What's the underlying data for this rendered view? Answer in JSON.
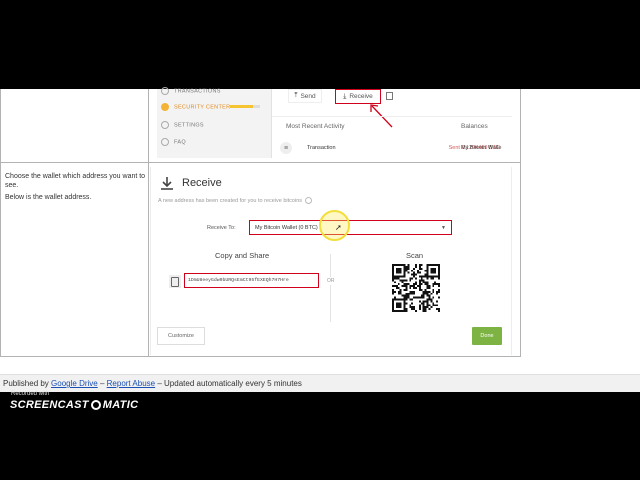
{
  "sidebar": {
    "items": [
      {
        "label": "TRANSACTIONS",
        "icon": "transactions-icon"
      },
      {
        "label": "SECURITY CENTER",
        "icon": "shield-icon",
        "active": true,
        "progress": 0.75
      },
      {
        "label": "SETTINGS",
        "icon": "gear-icon"
      },
      {
        "label": "FAQ",
        "icon": "question-icon"
      }
    ]
  },
  "toolbar": {
    "send_label": "Send",
    "receive_label": "Receive"
  },
  "activity": {
    "header": "Most Recent Activity",
    "balances_header": "Balances",
    "row": {
      "type": "Transaction",
      "amount": "Sent 0.1204469 BTC",
      "wallet": "My Bitcoin Walle"
    }
  },
  "instructions": {
    "line1": "Choose the wallet which address you want to see.",
    "line2": "Below is the wallet address."
  },
  "receive": {
    "title": "Receive",
    "subtitle": "A new address has been created for you to receive bitcoins",
    "receive_to_label": "Receive To:",
    "wallet_selected": "My Bitcoin Wallet  (0 BTC)",
    "copy_share": "Copy and Share",
    "or": "OR",
    "scan": "Scan",
    "address": "1DmU8eeyGdw9bURQsEmCt95fEXEQh7H7Hre",
    "customize_label": "Customize",
    "done_label": "Done"
  },
  "footer": {
    "published_by": "Published by",
    "google_drive": "Google Drive",
    "sep1": " – ",
    "report_abuse": "Report Abuse",
    "updated": " – Updated automatically every 5 minutes"
  },
  "watermark": {
    "recorded_with": "Recorded with",
    "brand_left": "SCREENCAST",
    "brand_right": "MATIC"
  },
  "colors": {
    "highlight_red": "#d0021b",
    "accent_orange": "#e08a1e",
    "done_green": "#7cb342",
    "link_blue": "#1a4fb4"
  }
}
